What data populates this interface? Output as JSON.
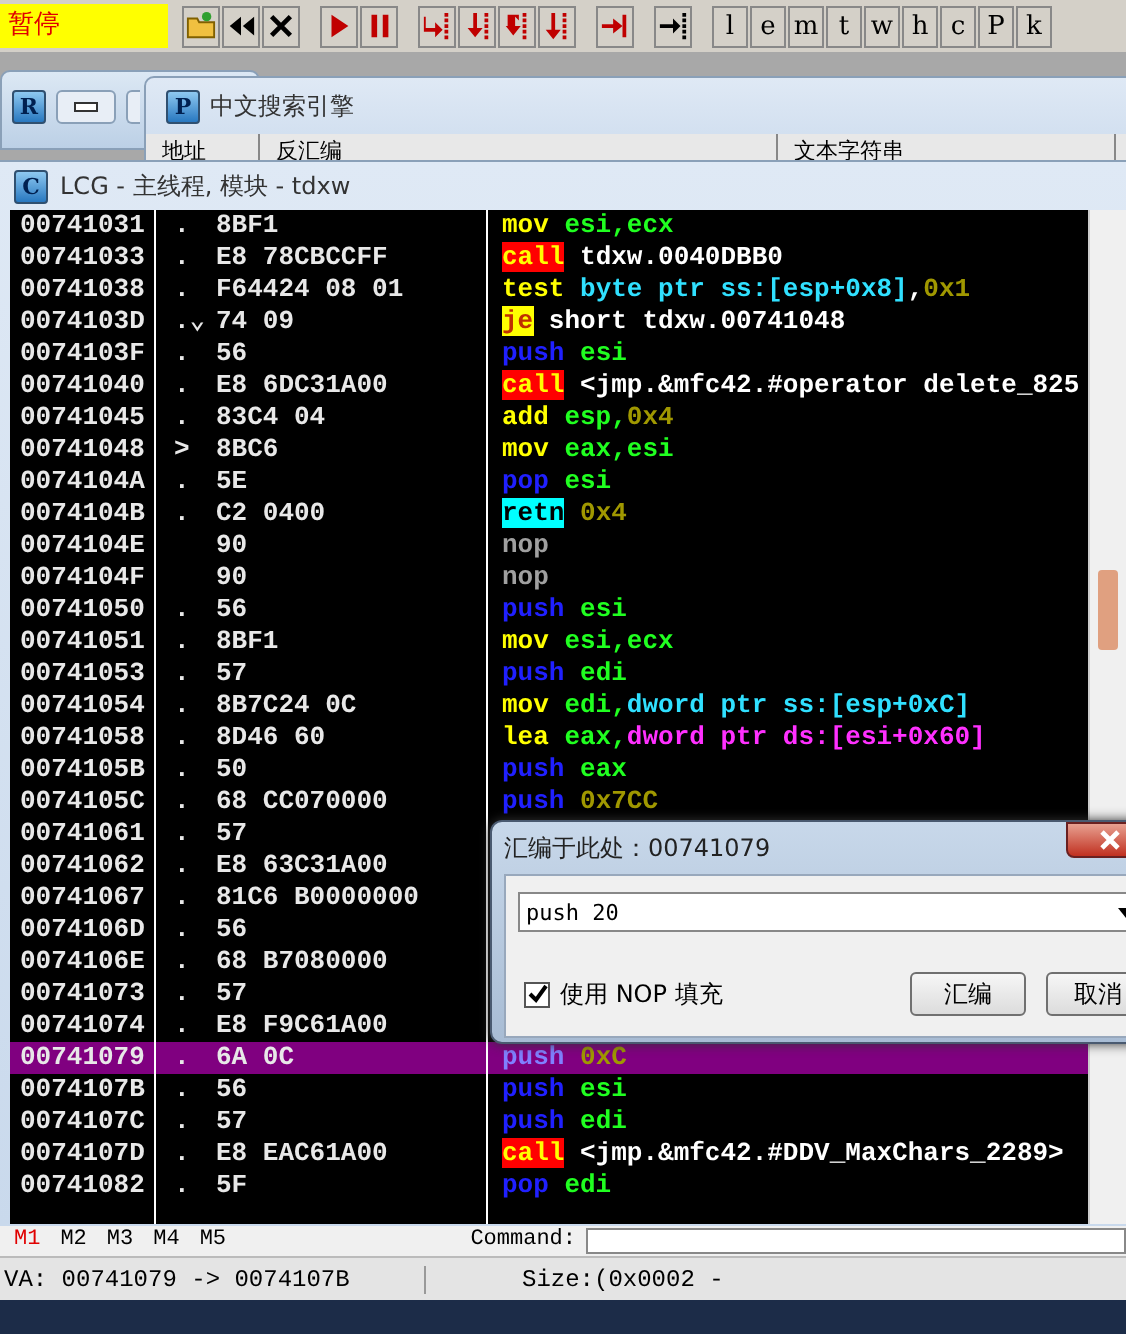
{
  "status_badge": "暂停",
  "toolbar": {
    "letter_buttons": [
      "l",
      "e",
      "m",
      "t",
      "w",
      "h",
      "c",
      "P",
      "k"
    ]
  },
  "r_window": {
    "icon": "R"
  },
  "search_window": {
    "icon": "P",
    "title": "中文搜索引擎",
    "columns": [
      "地址",
      "反汇编",
      "文本字符串"
    ]
  },
  "cpu_window": {
    "icon": "C",
    "title": "LCG - 主线程, 模块 - tdxw"
  },
  "disassembly": {
    "rows": [
      {
        "address": "00741031",
        "mark": ".",
        "hex": "8BF1",
        "selected": false,
        "code": [
          {
            "kind": "op",
            "text": "mov"
          },
          {
            "kind": "reg",
            "text": " esi,ecx"
          }
        ]
      },
      {
        "address": "00741033",
        "mark": ".",
        "hex": "E8 78CBCCFF",
        "selected": false,
        "code": [
          {
            "kind": "call",
            "text": "call"
          },
          {
            "kind": "plain",
            "text": " tdxw.0040DBB0"
          }
        ]
      },
      {
        "address": "00741038",
        "mark": ".",
        "hex": "F64424 08 01",
        "selected": false,
        "code": [
          {
            "kind": "op",
            "text": "test"
          },
          {
            "kind": "ss",
            "text": " byte ptr ss:[esp+0x8]"
          },
          {
            "kind": "plain",
            "text": ","
          },
          {
            "kind": "imm",
            "text": "0x1"
          }
        ]
      },
      {
        "address": "0074103D",
        "mark": ".⌄",
        "hex": "74 09",
        "selected": false,
        "code": [
          {
            "kind": "jump",
            "text": "je"
          },
          {
            "kind": "plain",
            "text": " short tdxw.00741048"
          }
        ]
      },
      {
        "address": "0074103F",
        "mark": ".",
        "hex": "56",
        "selected": false,
        "code": [
          {
            "kind": "stack",
            "text": "push"
          },
          {
            "kind": "reg",
            "text": " esi"
          }
        ]
      },
      {
        "address": "00741040",
        "mark": ".",
        "hex": "E8 6DC31A00",
        "selected": false,
        "code": [
          {
            "kind": "call",
            "text": "call"
          },
          {
            "kind": "plain",
            "text": " <jmp.&mfc42.#operator delete_825"
          }
        ]
      },
      {
        "address": "00741045",
        "mark": ".",
        "hex": "83C4 04",
        "selected": false,
        "code": [
          {
            "kind": "op",
            "text": "add"
          },
          {
            "kind": "reg",
            "text": " esp,"
          },
          {
            "kind": "imm",
            "text": "0x4"
          }
        ]
      },
      {
        "address": "00741048",
        "mark": ">",
        "hex": "8BC6",
        "selected": false,
        "code": [
          {
            "kind": "op",
            "text": "mov"
          },
          {
            "kind": "reg",
            "text": " eax,esi"
          }
        ]
      },
      {
        "address": "0074104A",
        "mark": ".",
        "hex": "5E",
        "selected": false,
        "code": [
          {
            "kind": "stack",
            "text": "pop"
          },
          {
            "kind": "reg",
            "text": " esi"
          }
        ]
      },
      {
        "address": "0074104B",
        "mark": ".",
        "hex": "C2 0400",
        "selected": false,
        "code": [
          {
            "kind": "ret",
            "text": "retn"
          },
          {
            "kind": "imm",
            "text": " 0x4"
          }
        ]
      },
      {
        "address": "0074104E",
        "hex": "90",
        "selected": false,
        "code": [
          {
            "kind": "nop",
            "text": "nop"
          }
        ]
      },
      {
        "address": "0074104F",
        "hex": "90",
        "selected": false,
        "code": [
          {
            "kind": "nop",
            "text": "nop"
          }
        ]
      },
      {
        "address": "00741050",
        "mark": ".",
        "hex": "56",
        "selected": false,
        "code": [
          {
            "kind": "stack",
            "text": "push"
          },
          {
            "kind": "reg",
            "text": " esi"
          }
        ]
      },
      {
        "address": "00741051",
        "mark": ".",
        "hex": "8BF1",
        "selected": false,
        "code": [
          {
            "kind": "op",
            "text": "mov"
          },
          {
            "kind": "reg",
            "text": " esi,ecx"
          }
        ]
      },
      {
        "address": "00741053",
        "mark": ".",
        "hex": "57",
        "selected": false,
        "code": [
          {
            "kind": "stack",
            "text": "push"
          },
          {
            "kind": "reg",
            "text": " edi"
          }
        ]
      },
      {
        "address": "00741054",
        "mark": ".",
        "hex": "8B7C24 0C",
        "selected": false,
        "code": [
          {
            "kind": "op",
            "text": "mov"
          },
          {
            "kind": "reg",
            "text": " edi,"
          },
          {
            "kind": "ss",
            "text": "dword ptr ss:[esp+0xC]"
          }
        ]
      },
      {
        "address": "00741058",
        "mark": ".",
        "hex": "8D46 60",
        "selected": false,
        "code": [
          {
            "kind": "op",
            "text": "lea"
          },
          {
            "kind": "reg",
            "text": " eax,"
          },
          {
            "kind": "ds",
            "text": "dword ptr ds:[esi+0x60]"
          }
        ]
      },
      {
        "address": "0074105B",
        "mark": ".",
        "hex": "50",
        "selected": false,
        "code": [
          {
            "kind": "stack",
            "text": "push"
          },
          {
            "kind": "reg",
            "text": " eax"
          }
        ]
      },
      {
        "address": "0074105C",
        "mark": ".",
        "hex": "68 CC070000",
        "selected": false,
        "code": [
          {
            "kind": "stack",
            "text": "push"
          },
          {
            "kind": "imm",
            "text": " 0x7CC"
          }
        ]
      },
      {
        "address": "00741061",
        "mark": ".",
        "hex": "57",
        "selected": false
      },
      {
        "address": "00741062",
        "mark": ".",
        "hex": "E8 63C31A00",
        "selected": false
      },
      {
        "address": "00741067",
        "mark": ".",
        "hex": "81C6 B0000000",
        "selected": false
      },
      {
        "address": "0074106D",
        "mark": ".",
        "hex": "56",
        "selected": false
      },
      {
        "address": "0074106E",
        "mark": ".",
        "hex": "68 B7080000",
        "selected": false
      },
      {
        "address": "00741073",
        "mark": ".",
        "hex": "57",
        "selected": false
      },
      {
        "address": "00741074",
        "mark": ".",
        "hex": "E8 F9C61A00",
        "selected": false
      },
      {
        "address": "00741079",
        "mark": ".",
        "hex": "6A 0C",
        "selected": true,
        "code": [
          {
            "kind": "stack",
            "text": "push"
          },
          {
            "kind": "imm",
            "text": " 0xC"
          }
        ]
      },
      {
        "address": "0074107B",
        "mark": ".",
        "hex": "56",
        "selected": false,
        "code": [
          {
            "kind": "stack",
            "text": "push"
          },
          {
            "kind": "reg",
            "text": " esi"
          }
        ]
      },
      {
        "address": "0074107C",
        "mark": ".",
        "hex": "57",
        "selected": false,
        "code": [
          {
            "kind": "stack",
            "text": "push"
          },
          {
            "kind": "reg",
            "text": " edi"
          }
        ]
      },
      {
        "address": "0074107D",
        "mark": ".",
        "hex": "E8 EAC61A00",
        "selected": false,
        "code": [
          {
            "kind": "call",
            "text": "call"
          },
          {
            "kind": "plain",
            "text": " <jmp.&mfc42.#DDV_MaxChars_2289>"
          }
        ]
      },
      {
        "address": "00741082",
        "mark": ".",
        "hex": "5F",
        "selected": false,
        "code": [
          {
            "kind": "stack",
            "text": "pop"
          },
          {
            "kind": "reg",
            "text": " edi"
          }
        ]
      }
    ]
  },
  "assemble_dialog": {
    "title": "汇编于此处：00741079",
    "value": "push 20",
    "nop_fill": {
      "label": "使用 NOP 填充",
      "checked": true
    },
    "buttons": [
      "汇编",
      "取消"
    ]
  },
  "bottom_tabs": [
    {
      "label": "M1",
      "selected": true
    },
    {
      "label": "M2",
      "selected": false
    },
    {
      "label": "M3",
      "selected": false
    },
    {
      "label": "M4",
      "selected": false
    },
    {
      "label": "M5",
      "selected": false
    }
  ],
  "command_label": "Command:",
  "status_bar": {
    "va": "VA: 00741079 -> 0074107B",
    "size": "Size:(0x0002 -"
  }
}
